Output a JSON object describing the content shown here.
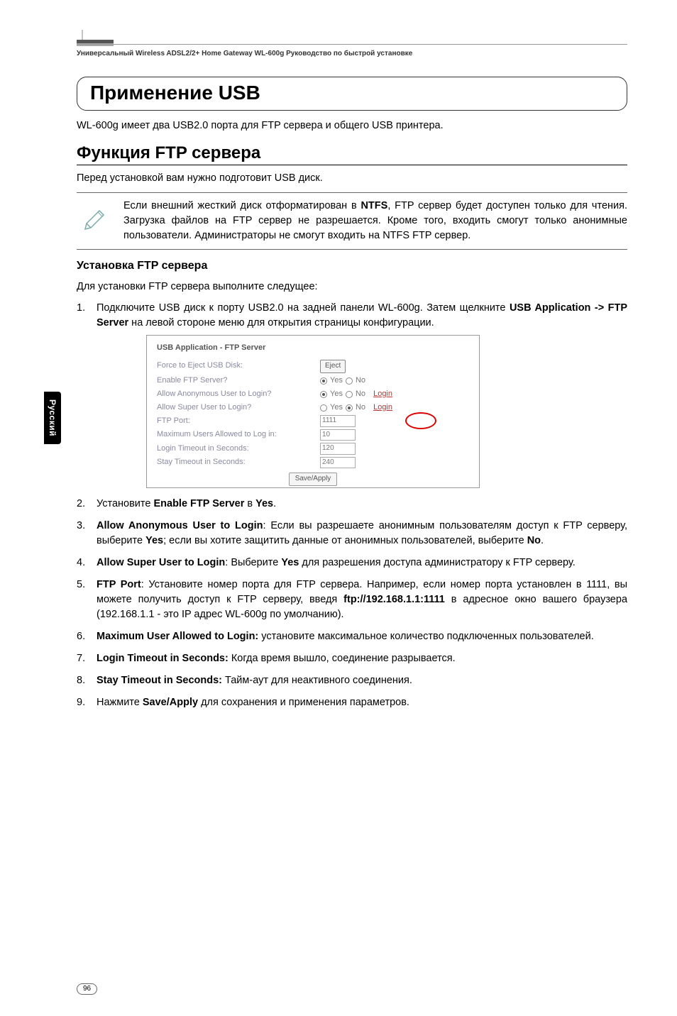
{
  "header": {
    "text": "Универсальный Wireless ADSL2/2+ Home Gateway  WL-600g Руководство по быстрой установке"
  },
  "sideTab": "Русский",
  "pageNumber": "96",
  "section": {
    "title": "Применение USB",
    "intro": "WL-600g имеет два USB2.0 порта для FTP сервера и общего USB принтера.",
    "subTitle": "Функция FTP сервера",
    "prep": "Перед установкой вам нужно подготовит USB диск.",
    "note": {
      "t1": "Если внешний жесткий диск отформатирован в ",
      "ntfs": "NTFS",
      "t2": ", FTP сервер будет доступен только для чтения. Загрузка файлов на FTP сервер не разрешается. Кроме того, входить смогут только анонимные пользователи. Администраторы  не смогут входить на NTFS FTP сервер."
    },
    "subHeading": "Установка FTP сервера",
    "lead": "Для установки FTP сервера выполните следущее:",
    "step1": {
      "t1": "Подключите USB диск к порту USB2.0 на задней панели WL-600g. Затем щелкните ",
      "b1": "USB Application -> FTP Server",
      "t2": " на левой стороне меню для открытия страницы конфигурации."
    },
    "screenshot": {
      "panelTitle": "USB Application - FTP Server",
      "rows": {
        "forceEject": "Force to Eject USB Disk:",
        "ejectBtn": "Eject",
        "enable": "Enable FTP Server?",
        "allowAnon": "Allow Anonymous User to Login?",
        "allowSuper": "Allow Super User to Login?",
        "ftpPort": "FTP Port:",
        "ftpPortVal": "1111",
        "maxUsers": "Maximum Users Allowed to Log in:",
        "maxUsersVal": "10",
        "loginTimeout": "Login Timeout in Seconds:",
        "loginTimeoutVal": "120",
        "stayTimeout": "Stay Timeout in Seconds:",
        "stayTimeoutVal": "240",
        "yes": "Yes",
        "no": "No",
        "login": "Login",
        "saveApply": "Save/Apply"
      }
    },
    "step2": {
      "t1": "Установите ",
      "b1": "Enable FTP Server",
      "t2": " в ",
      "b2": "Yes",
      "t3": "."
    },
    "step3": {
      "b1": "Allow Anonymous User to Login",
      "t1": ": Если вы разрешаете анонимным пользователям доступ к FTP серверу, выберите ",
      "b2": "Yes",
      "t2": "; если вы хотите защитить данные от анонимных пользователей, выберите ",
      "b3": "No",
      "t3": "."
    },
    "step4": {
      "b1": "Allow Super User to Login",
      "t1": ": Выберите ",
      "b2": "Yes",
      "t2": " для разрешения доступа администратору к FTP серверу."
    },
    "step5": {
      "b1": "FTP Port",
      "t1": ": Установите номер порта для FTP сервера. Например, если номер порта установлен в 1111, вы можете получить доступ к FTP серверу, введя ",
      "b2": "ftp://192.168.1.1:1111",
      "t2": " в адресное окно вашего браузера (192.168.1.1 - это IP адрес WL-600g по умолчанию)."
    },
    "step6": {
      "b1": "Maximum User Allowed to Login:",
      "t1": " установите максимальное количество подключенных пользователей."
    },
    "step7": {
      "b1": "Login Timeout in Seconds:",
      "t1": " Когда время вышло, соединение разрывается."
    },
    "step8": {
      "b1": "Stay Timeout in Seconds:",
      "t1": " Тайм-аут для неактивного соединения."
    },
    "step9": {
      "t1": "Нажмите ",
      "b1": "Save/Apply",
      "t2": " для сохранения и применения параметров."
    }
  }
}
